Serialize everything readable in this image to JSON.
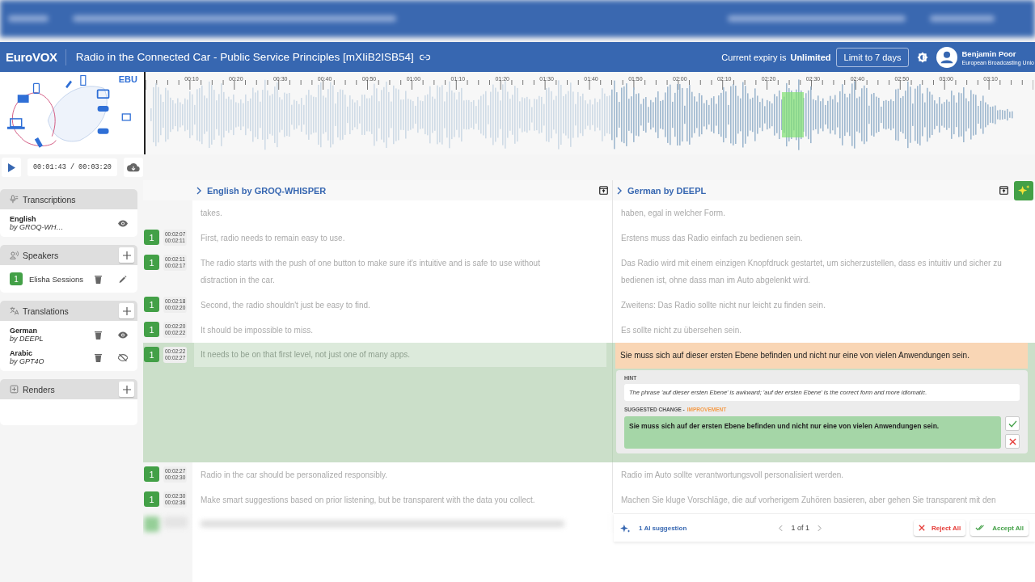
{
  "header": {
    "logo": "EuroVOX",
    "title": "Radio in the Connected Car - Public Service Principles [mXIiB2ISB54]",
    "expiry_label": "Current expiry is",
    "expiry_value": "Unlimited",
    "limit_button": "Limit to 7 days",
    "user": {
      "name": "Benjamin Poor",
      "org": "European Broadcasting Unio"
    }
  },
  "media": {
    "brand": "EBU",
    "timeline": [
      "00:10",
      "00:20",
      "00:30",
      "00:40",
      "00:50",
      "01:00",
      "01:10",
      "01:20",
      "01:30",
      "01:40",
      "01:50",
      "02:00",
      "02:10",
      "02:20",
      "02:30",
      "02:40",
      "02:50",
      "03:00",
      "03:10"
    ],
    "time": "00:01:43 / 00:03:20"
  },
  "sidebar": {
    "sections": [
      {
        "kind": "transcriptions",
        "title": "Transcriptions",
        "addable": false,
        "items": [
          {
            "kind": "track",
            "language": "English",
            "engine": "by GROQ-WH…",
            "visible": true
          }
        ]
      },
      {
        "kind": "speakers",
        "title": "Speakers",
        "addable": true,
        "items": [
          {
            "kind": "speaker",
            "badge": "1",
            "name": "Elisha Sessions"
          }
        ]
      },
      {
        "kind": "translations",
        "title": "Translations",
        "addable": true,
        "items": [
          {
            "kind": "track",
            "language": "German",
            "engine": "by DEEPL",
            "visible": true
          },
          {
            "kind": "track",
            "language": "Arabic",
            "engine": "by GPT4O",
            "visible": false
          }
        ]
      },
      {
        "kind": "renders",
        "title": "Renders",
        "addable": true
      }
    ]
  },
  "columns": [
    {
      "title": "English by GROQ-WHISPER"
    },
    {
      "title": "German by DEEPL"
    }
  ],
  "segments": [
    {
      "source": "takes.",
      "target": "haben, egal in welcher Form.",
      "selected": false
    },
    {
      "speaker": "1",
      "start": "00:02:07",
      "end": "00:02:11",
      "source": "First, radio needs to remain easy to use.",
      "target": "Erstens muss das Radio einfach zu bedienen sein.",
      "selected": false
    },
    {
      "speaker": "1",
      "start": "00:02:11",
      "end": "00:02:17",
      "source": "The radio starts with the push of one button to make sure it's intuitive and is safe to use without distraction in the car.",
      "target": "Das Radio wird mit einem einzigen Knopfdruck gestartet, um sicherzustellen, dass es intuitiv und sicher zu bedienen ist, ohne dass man im Auto abgelenkt wird.",
      "selected": false
    },
    {
      "speaker": "1",
      "start": "00:02:18",
      "end": "00:02:20",
      "source": "Second, the radio shouldn't just be easy to find.",
      "target": "Zweitens: Das Radio sollte nicht nur leicht zu finden sein.",
      "selected": false
    },
    {
      "speaker": "1",
      "start": "00:02:20",
      "end": "00:02:22",
      "source": "It should be impossible to miss.",
      "target": "Es sollte nicht zu übersehen sein.",
      "selected": false
    },
    {
      "speaker": "1",
      "start": "00:02:22",
      "end": "00:02:27",
      "source": "It needs to be on that first level, not just one of many apps.",
      "target": "Sie muss sich auf dieser ersten Ebene befinden und nicht nur eine von vielen Anwendungen sein.",
      "selected": true,
      "suggestion": {
        "hint_label": "HINT",
        "hint": "The phrase 'auf dieser ersten Ebene' is awkward; 'auf der ersten Ebene' is the correct form and more idiomatic.",
        "change_label": "SUGGESTED CHANGE -",
        "change_type": "IMPROVEMENT",
        "text": "Sie muss sich auf der ersten Ebene befinden und nicht nur eine von vielen Anwendungen sein."
      }
    },
    {
      "speaker": "1",
      "start": "00:02:27",
      "end": "00:02:30",
      "source": "Radio in the car should be personalized responsibly.",
      "target": "Radio im Auto sollte verantwortungsvoll personalisiert werden.",
      "selected": false
    },
    {
      "speaker": "1",
      "start": "00:02:30",
      "end": "00:02:36",
      "source": "Make smart suggestions based on prior listening, but be transparent with the data you collect.",
      "target": "Machen Sie kluge Vorschläge, die auf vorherigem Zuhören basieren, aber gehen Sie transparent mit den",
      "selected": false
    }
  ],
  "ai_bar": {
    "count_label": "1 AI suggestion",
    "pager": "1 of 1",
    "reject": "Reject All",
    "accept": "Accept All"
  }
}
